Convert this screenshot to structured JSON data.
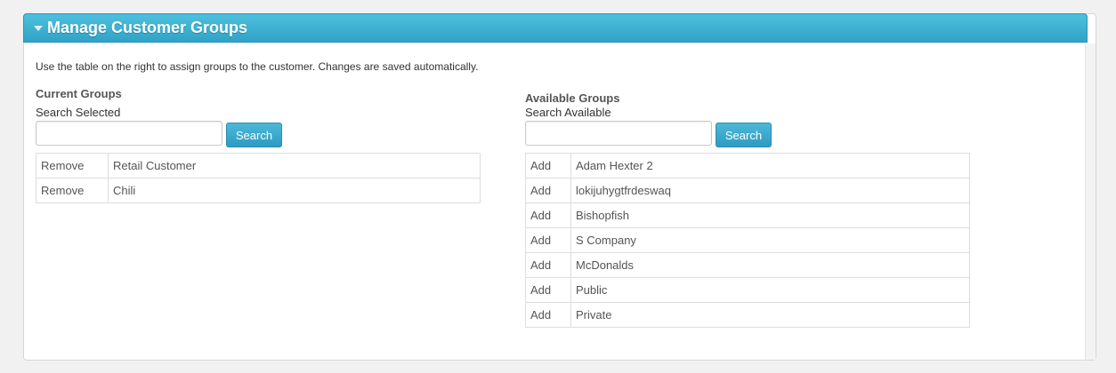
{
  "panel": {
    "title": "Manage Customer Groups",
    "collapse_icon": "triangle-down-icon",
    "instructions": "Use the table on the right to assign groups to the customer. Changes are saved automatically."
  },
  "current_groups": {
    "title": "Current Groups",
    "search_label": "Search Selected",
    "search_value": "",
    "search_button": "Search",
    "rows": [
      {
        "action": "Remove",
        "name": "Retail Customer"
      },
      {
        "action": "Remove",
        "name": "Chili"
      }
    ]
  },
  "available_groups": {
    "title": "Available Groups",
    "search_label": "Search Available",
    "search_value": "",
    "search_button": "Search",
    "rows": [
      {
        "action": "Add",
        "name": "Adam Hexter 2"
      },
      {
        "action": "Add",
        "name": "lokijuhygtfrdeswaq"
      },
      {
        "action": "Add",
        "name": "Bishopfish"
      },
      {
        "action": "Add",
        "name": "S Company"
      },
      {
        "action": "Add",
        "name": "McDonalds"
      },
      {
        "action": "Add",
        "name": "Public"
      },
      {
        "action": "Add",
        "name": "Private"
      }
    ]
  },
  "colors": {
    "header_top": "#4fc0dd",
    "header_bottom": "#2fa3c8",
    "button": "#2d9bc2"
  }
}
